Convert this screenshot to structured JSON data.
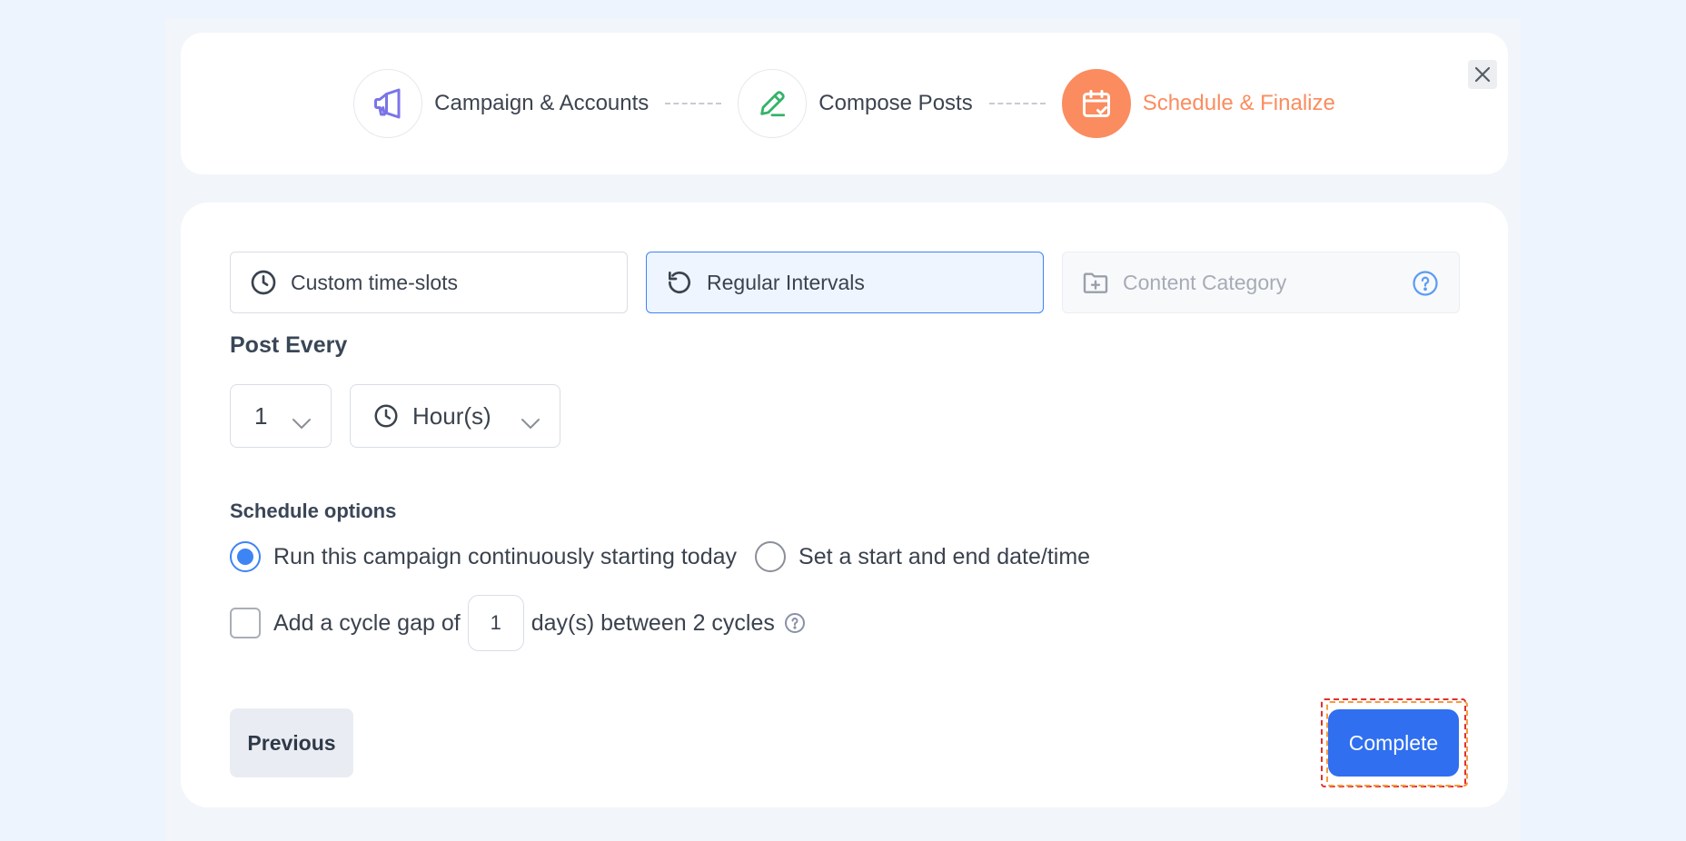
{
  "steps": [
    {
      "label": "Campaign & Accounts",
      "icon": "megaphone-icon",
      "color": "#7b74e8"
    },
    {
      "label": "Compose Posts",
      "icon": "pencil-icon",
      "color": "#34b36a"
    },
    {
      "label": "Schedule & Finalize",
      "icon": "calendar-check-icon",
      "color": "#fb8c5f",
      "active": true
    }
  ],
  "tabs": [
    {
      "label": "Custom time-slots",
      "icon": "clock-icon"
    },
    {
      "label": "Regular Intervals",
      "icon": "refresh-icon",
      "active": true
    },
    {
      "label": "Content Category",
      "icon": "folder-plus-icon",
      "disabled": true
    }
  ],
  "post_every": {
    "title": "Post Every",
    "number_value": "1",
    "unit_value": "Hour(s)"
  },
  "schedule_options": {
    "title": "Schedule options",
    "options": [
      {
        "label": "Run this campaign continuously starting today",
        "checked": true
      },
      {
        "label": "Set a start and end date/time",
        "checked": false
      }
    ]
  },
  "cycle_gap": {
    "prefix": "Add a cycle gap of",
    "value": "1",
    "suffix": "day(s) between 2 cycles",
    "checked": false
  },
  "buttons": {
    "previous": "Previous",
    "complete": "Complete"
  },
  "colors": {
    "accent": "#3d84f5",
    "active_step": "#fb8c5f",
    "complete_button": "#2f6ff0"
  }
}
